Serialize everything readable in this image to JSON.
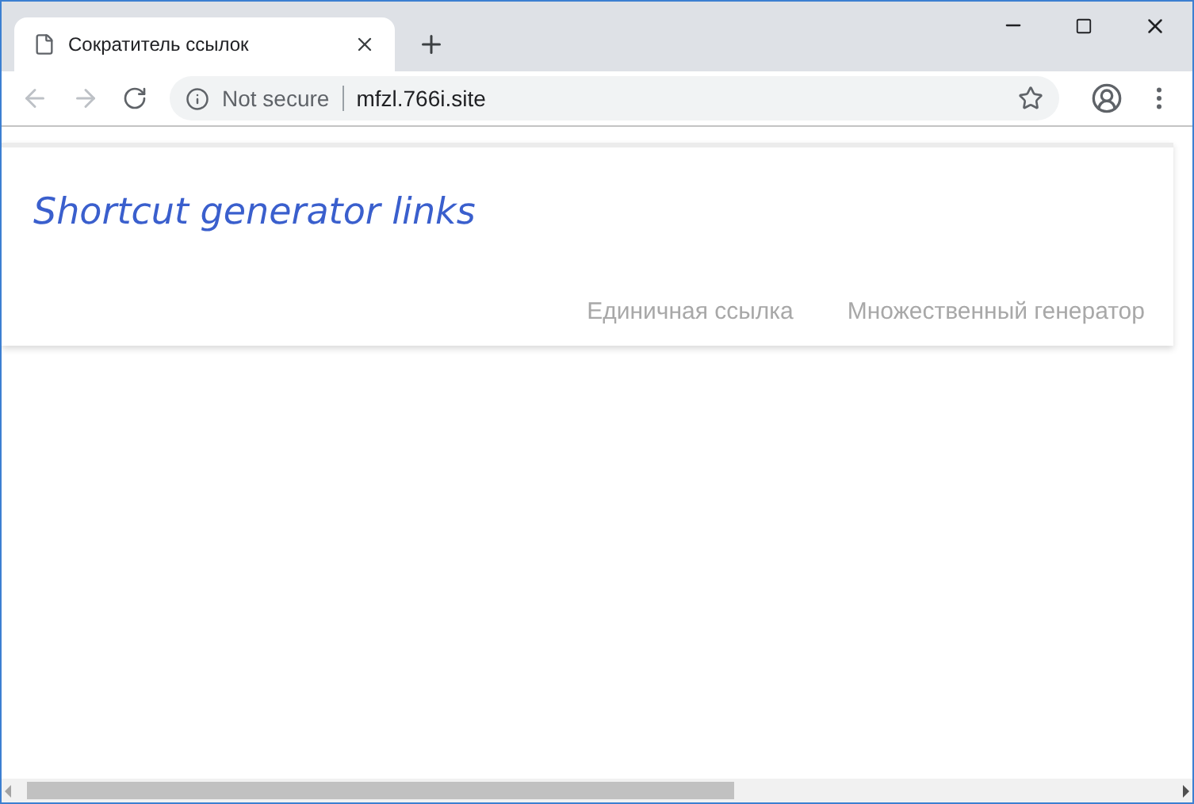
{
  "browser": {
    "tab": {
      "title": "Сократитель ссылок"
    },
    "address": {
      "security": "Not secure",
      "url": "mfzl.766i.site"
    }
  },
  "page": {
    "logo": "Shortcut generator links",
    "nav": [
      {
        "label": "Единичная ссылка"
      },
      {
        "label": "Множественный генератор"
      }
    ]
  }
}
